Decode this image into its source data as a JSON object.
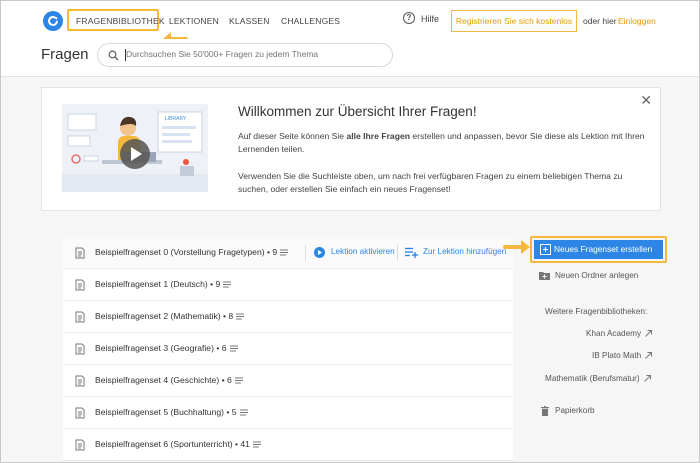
{
  "nav": {
    "items": [
      "FRAGENBIBLIOTHEK",
      "LEKTIONEN",
      "KLASSEN",
      "CHALLENGES"
    ],
    "help": "Hilfe",
    "register": "Registrieren Sie sich kostenlos",
    "or_text": "oder hier",
    "login": "Einloggen"
  },
  "header": {
    "title": "Fragen",
    "search_placeholder": "Durchsuchen Sie 50'000+ Fragen zu jedem Thema"
  },
  "welcome": {
    "title": "Willkommen zur Übersicht Ihrer Fragen!",
    "p1_before": "Auf dieser Seite können Sie ",
    "p1_bold": "alle Ihre Fragen",
    "p1_after": " erstellen und anpassen, bevor Sie diese als Lektion mit Ihren Lernenden teilen.",
    "p2": "Verwenden Sie die Suchleiste oben, um nach frei verfügbaren Fragen zu einem beliebigen Thema zu suchen, oder erstellen Sie einfach ein neues Fragenset!",
    "illustration_label": "LIBRARY"
  },
  "sets": [
    {
      "title": "Beispielfragenset 0 (Vorstellung Fragetypen)",
      "count": "9"
    },
    {
      "title": "Beispielfragenset 1 (Deutsch)",
      "count": "9"
    },
    {
      "title": "Beispielfragenset 2 (Mathematik)",
      "count": "8"
    },
    {
      "title": "Beispielfragenset 3 (Geografie)",
      "count": "6"
    },
    {
      "title": "Beispielfragenset 4 (Geschichte)",
      "count": "6"
    },
    {
      "title": "Beispielfragenset 5 (Buchhaltung)",
      "count": "5"
    },
    {
      "title": "Beispielfragenset 6 (Sportunterricht)",
      "count": "41"
    }
  ],
  "row_actions": {
    "activate": "Lektion aktivieren",
    "add": "Zur Lektion hinzufügen"
  },
  "sidebar": {
    "new_set": "Neues Fragenset erstellen",
    "new_folder": "Neuen Ordner anlegen",
    "more_libraries": "Weitere Fragenbibliotheken:",
    "libraries": [
      "Khan Academy",
      "IB Plato Math",
      "Mathematik (Berufsmatur)"
    ],
    "trash": "Papierkorb"
  },
  "colors": {
    "accent": "#2d86e6",
    "highlight": "#f5b83d",
    "login": "#e59a00"
  }
}
